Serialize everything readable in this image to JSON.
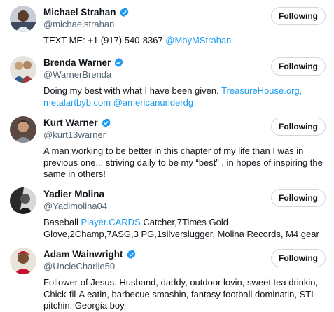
{
  "colors": {
    "link": "#1d9bf0",
    "verified": "#1d9bf0",
    "secondary_text": "#536471",
    "button_border": "#cfd9de"
  },
  "users": [
    {
      "name": "Michael Strahan",
      "verified": true,
      "handle": "@michaelstrahan",
      "bio_text_1": "TEXT ME: +1 (917) 540-8367 ",
      "bio_link_1": "@MbyMStrahan",
      "button_label": "Following"
    },
    {
      "name": "Brenda Warner",
      "verified": true,
      "handle": "@WarnerBrenda",
      "bio_text_1": "Doing my best with what I have been given. ",
      "bio_link_1": "TreasureHouse.org,",
      "bio_link_2": "metalartbyb.com",
      "bio_link_3": "@americanunderdg",
      "button_label": "Following"
    },
    {
      "name": "Kurt Warner",
      "verified": true,
      "handle": "@kurt13warner",
      "bio_text_1": "A man working to be better in this chapter of my life than I was in previous one... striving daily to be my “best” , in hopes of inspiring the same in others!",
      "button_label": "Following"
    },
    {
      "name": "Yadier Molina",
      "verified": false,
      "handle": "@Yadimolina04",
      "bio_text_1": "Baseball ",
      "bio_link_1": "Player.CARDS",
      "bio_text_2": " Catcher,7Times Gold Glove,2Champ,7ASG,3 PG,1silverslugger, Molina Records, M4 gear",
      "button_label": "Following"
    },
    {
      "name": "Adam Wainwright",
      "verified": true,
      "handle": "@UncleCharlie50",
      "bio_text_1": "Follower of Jesus. Husband, daddy, outdoor lovin, sweet tea drinkin, Chick-fil-A eatin, barbecue smashin, fantasy football dominatin, STL pitchin, Georgia boy.",
      "button_label": "Following"
    }
  ]
}
